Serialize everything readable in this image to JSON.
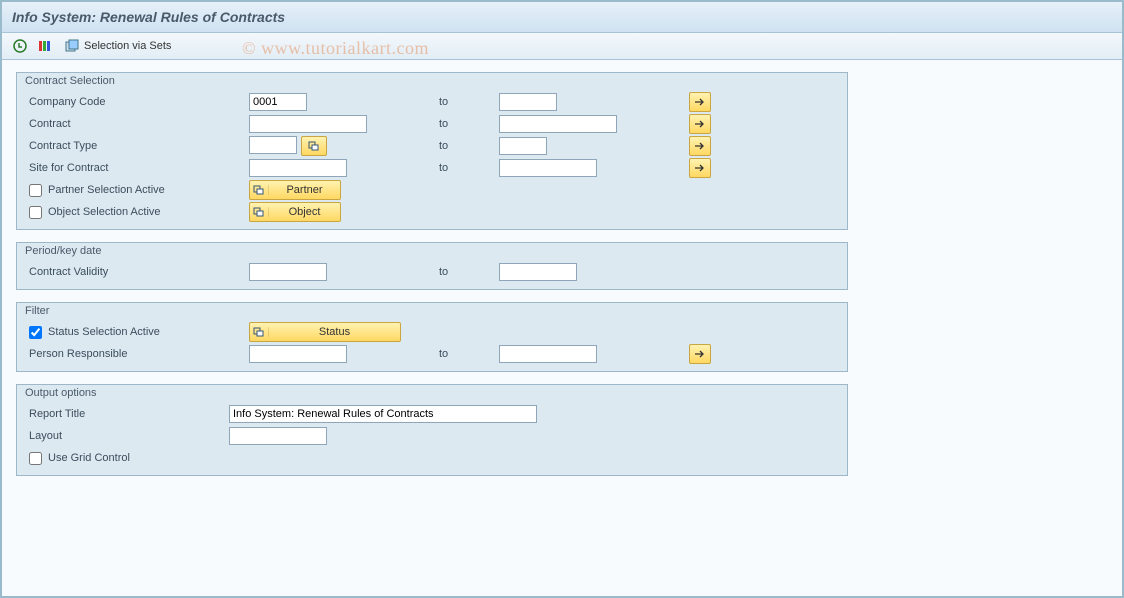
{
  "title": "Info System: Renewal Rules of Contracts",
  "watermark": "© www.tutorialkart.com",
  "toolbar": {
    "selection_via_sets": "Selection via Sets"
  },
  "groups": {
    "contract_selection": {
      "title": "Contract Selection",
      "company_code": {
        "label": "Company Code",
        "from": "0001",
        "to": ""
      },
      "contract": {
        "label": "Contract",
        "from": "",
        "to": ""
      },
      "contract_type": {
        "label": "Contract Type",
        "from": "",
        "to": ""
      },
      "site": {
        "label": "Site for Contract",
        "from": "",
        "to": ""
      },
      "partner_sel": {
        "label": "Partner Selection Active",
        "checked": false,
        "button": "Partner"
      },
      "object_sel": {
        "label": "Object Selection Active",
        "checked": false,
        "button": "Object"
      }
    },
    "period": {
      "title": "Period/key date",
      "validity": {
        "label": "Contract Validity",
        "from": "",
        "to": ""
      }
    },
    "filter": {
      "title": "Filter",
      "status_sel": {
        "label": "Status Selection Active",
        "checked": true,
        "button": "Status"
      },
      "person": {
        "label": "Person Responsible",
        "from": "",
        "to": ""
      }
    },
    "output": {
      "title": "Output options",
      "report_title": {
        "label": "Report Title",
        "value": "Info System: Renewal Rules of Contracts"
      },
      "layout": {
        "label": "Layout",
        "value": ""
      },
      "grid": {
        "label": "Use Grid Control",
        "checked": false
      }
    }
  },
  "labels": {
    "to": "to"
  }
}
